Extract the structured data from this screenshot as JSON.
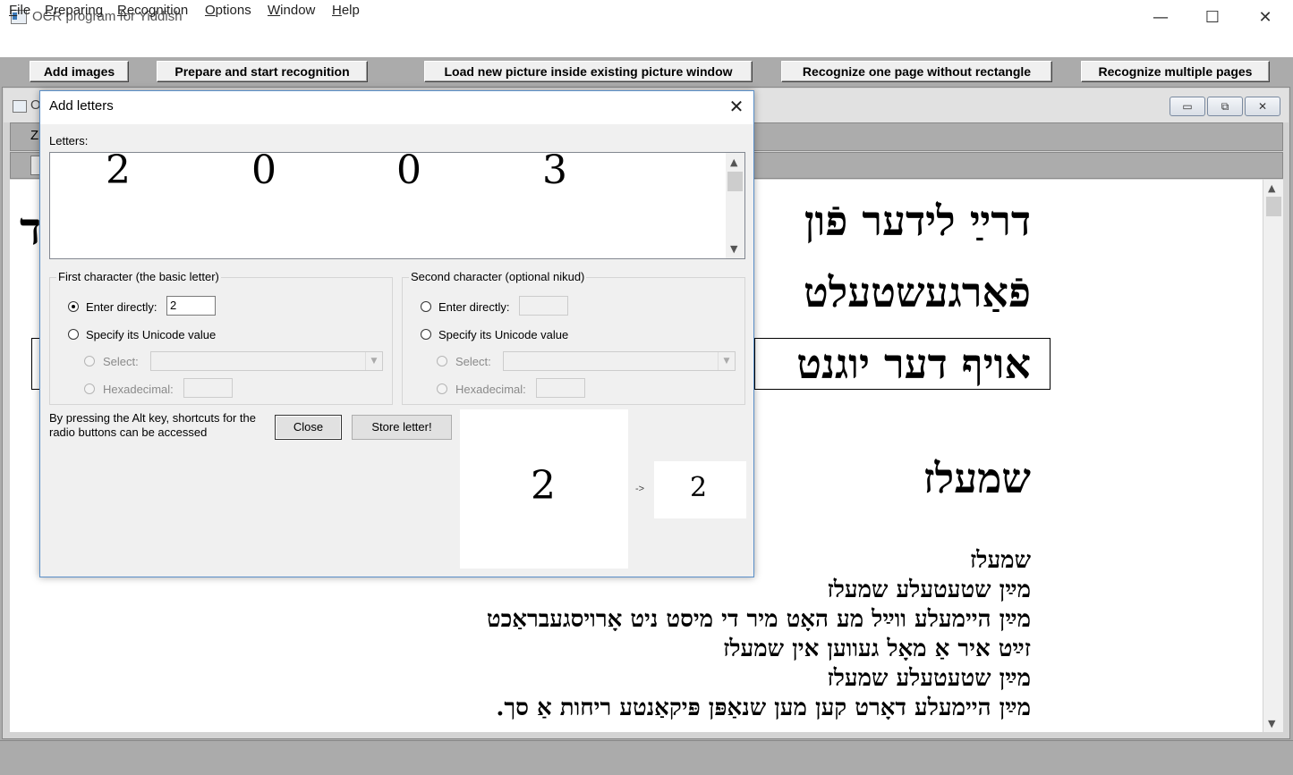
{
  "app": {
    "title": "OCR program for Yiddish",
    "window_controls": {
      "minimize": "—",
      "maximize": "☐",
      "close": "✕"
    }
  },
  "menu": [
    "File",
    "Preparing",
    "Recognition",
    "Options",
    "Window",
    "Help"
  ],
  "toolbar": {
    "add_images": "Add images",
    "prepare_start": "Prepare and start recognition",
    "load_new_picture": "Load new picture inside existing picture window",
    "recognize_one_page": "Recognize one page without rectangle",
    "recognize_multiple": "Recognize multiple pages"
  },
  "mdi": {
    "title_char": "O",
    "bar1_char": "Z",
    "controls": {
      "minimize": "▭",
      "restore": "⧉",
      "close": "✕"
    },
    "left_fragment_char": "ד",
    "document_lines": {
      "line1": "דרײַ לידער פֿון",
      "line2": "פֿאַרגעשטעלט",
      "line3": "אויף דער יוגנט",
      "heading": "שמעלז",
      "poem": [
        "שמעלז",
        "מײַן שטעטעלע שמעלז",
        "מײַן היימעלע ווײַל מע האָט מיר די מיסט ניט אָרויסגעבראַכט",
        "זײַט איר אַ מאָל געווען אין שמעלז",
        "מײַן שטעטעלע שמעלז",
        "מײַן היימעלע דאָרט קען מען שנאַפּן פּיקאַנטע ריחות אַ סך."
      ]
    }
  },
  "dialog": {
    "title": "Add letters",
    "close_x": "✕",
    "letters_label": "Letters:",
    "letters": [
      "2",
      "0",
      "0",
      "3"
    ],
    "first_group": {
      "legend": "First character (the basic letter)",
      "enter_directly": "Enter directly:",
      "enter_value": "2",
      "specify_unicode": "Specify its Unicode value",
      "select": "Select:",
      "hexadecimal": "Hexadecimal:"
    },
    "second_group": {
      "legend": "Second character (optional nikud)",
      "enter_directly": "Enter directly:",
      "enter_value": "",
      "specify_unicode": "Specify its Unicode value",
      "select": "Select:",
      "hexadecimal": "Hexadecimal:"
    },
    "hint": "By pressing the Alt key, shortcuts for the radio buttons can be accessed",
    "close_button": "Close",
    "store_button": "Store letter!",
    "preview_glyph": "2",
    "preview_arrow": "->",
    "preview_result": "2"
  }
}
